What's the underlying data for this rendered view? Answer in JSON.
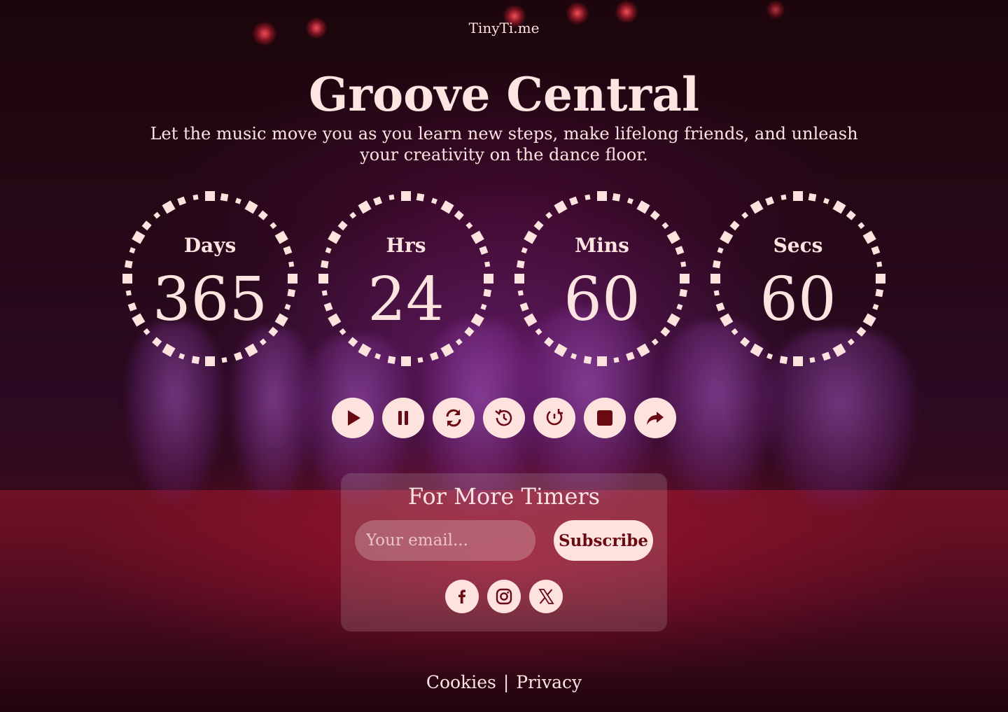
{
  "brand": "TinyTi.me",
  "hero": {
    "title": "Groove Central",
    "subtitle": "Let the music move you as you learn new steps, make lifelong friends, and unleash your creativity on the dance floor."
  },
  "countdown": [
    {
      "label": "Days",
      "value": "365"
    },
    {
      "label": "Hrs",
      "value": "24"
    },
    {
      "label": "Mins",
      "value": "60"
    },
    {
      "label": "Secs",
      "value": "60"
    }
  ],
  "controls": [
    "play-icon",
    "pause-icon",
    "refresh-icon",
    "history-icon",
    "clock-reset-icon",
    "stop-icon",
    "share-icon"
  ],
  "subscribe": {
    "title": "For More Timers",
    "email_placeholder": "Your email...",
    "button_label": "Subscribe"
  },
  "socials": [
    "facebook-icon",
    "instagram-icon",
    "x-icon"
  ],
  "footer": {
    "cookies": "Cookies",
    "separator": "|",
    "privacy": "Privacy"
  },
  "colors": {
    "accent": "#fde2de",
    "icon": "#6a0a12",
    "text": "#fde4e0"
  }
}
